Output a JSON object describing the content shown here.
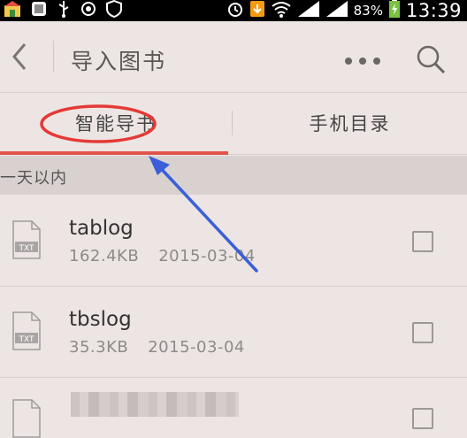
{
  "status_bar": {
    "battery_percent": "83%",
    "time": "13:39"
  },
  "app_bar": {
    "title": "导入图书"
  },
  "tabs": [
    {
      "label": "智能导书",
      "selected": true
    },
    {
      "label": "手机目录",
      "selected": false
    }
  ],
  "section": {
    "label": "一天以内"
  },
  "files": [
    {
      "name": "tablog",
      "size": "162.4KB",
      "date": "2015-03-04",
      "icon_label": "TXT",
      "checked": false
    },
    {
      "name": "tbslog",
      "size": "35.3KB",
      "date": "2015-03-04",
      "icon_label": "TXT",
      "checked": false
    }
  ],
  "colors": {
    "accent": "#e2534a",
    "annotation_ellipse": "#e53935",
    "annotation_arrow": "#3a5fd9"
  }
}
